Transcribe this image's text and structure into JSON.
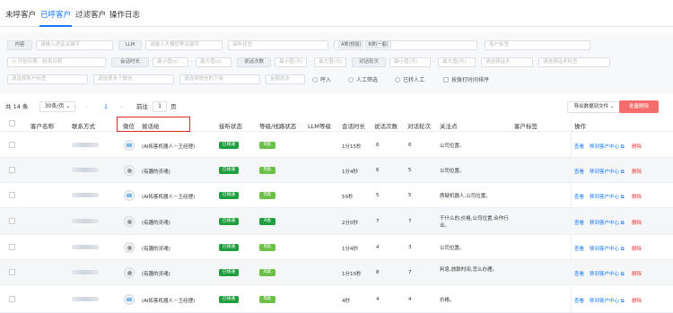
{
  "tabs": [
    {
      "label": "未呼客户"
    },
    {
      "label": "已呼客户"
    },
    {
      "label": "过滤客户"
    },
    {
      "label": "操作日志"
    }
  ],
  "filters": {
    "content_label": "内容",
    "content_ph": "请输入语音关键字",
    "llm_label": "LLM",
    "llm_ph": "请输入大模型等关键字",
    "connect_status_ph": "接听状态",
    "level_tags": [
      "A类(较强)",
      "B类(一般)"
    ],
    "customer_tag_ph": "客户标签",
    "start_date_ph": "开始日期",
    "end_date_ph": "结束日期",
    "duration_label": "会话时长",
    "duration_min": "最小值(s)",
    "duration_max": "最大值(s)",
    "count_label": "说话次数",
    "count_min": "最小值(次)",
    "count_max": "最大值(次)",
    "rounds_label": "对话轮次",
    "rounds_min": "最小值(次)",
    "rounds_max": "最大值(次)",
    "script_ph": "请选择话术",
    "script_tag_ph": "请选择话术标签",
    "account_ph": "请选择账户标签",
    "multi_ph": "请选择多个微信",
    "wechat_ph": "请选择微信的下级",
    "amount_ph": "金额状态",
    "check_called": "呼入",
    "check_manual": "人工筛选",
    "check_added": "已转人工",
    "check_sort": "按拨打时间排序"
  },
  "pagination": {
    "total": "共 14 条",
    "size": "30条/页",
    "page": "1",
    "goto": "前往",
    "goto_value": "1",
    "page_unit": "页"
  },
  "actions": {
    "export": "导出数据到文件",
    "delete": "批量删除"
  },
  "columns": [
    "客户名称",
    "联系方式",
    "微信",
    "拨话给",
    "接听状态",
    "等级/线路状态",
    "LLM等级",
    "会话时长",
    "说话次数",
    "对话轮次",
    "关注点",
    "客户标签",
    "操作"
  ],
  "rows": [
    {
      "avatar": "robot-avatar",
      "dial": "(AI拓客机器人－王经理)",
      "status": "已接通",
      "level": "B类",
      "level_color": "#6cc04a",
      "duration": "1分15秒",
      "count": "6",
      "rounds": "6",
      "focus": "公司位置。",
      "actions": [
        "查看",
        "移到客户中心",
        "删除"
      ]
    },
    {
      "avatar": "person-avatar",
      "dial": "(有趣的灵魂)",
      "status": "已接通",
      "level": "B类",
      "level_color": "#6cc04a",
      "duration": "1分4秒",
      "count": "6",
      "rounds": "5",
      "focus": "公司位置。",
      "actions": [
        "查看",
        "移到客户中心",
        "删除"
      ]
    },
    {
      "avatar": "robot-avatar",
      "dial": "(AI拓客机器人－王经理)",
      "status": "已接通",
      "level": "B类",
      "level_color": "#6cc04a",
      "duration": "59秒",
      "count": "5",
      "rounds": "5",
      "focus": "质疑机器人,公司位置。",
      "actions": [
        "查看",
        "移到客户中心",
        "删除"
      ]
    },
    {
      "avatar": "person-avatar",
      "dial": "(有趣的灵魂)",
      "status": "已接通",
      "level": "A类",
      "level_color": "#1e9e3e",
      "duration": "2分0秒",
      "count": "7",
      "rounds": "7",
      "focus": "干什么的,价格,公司位置,合作行业。",
      "actions": [
        "查看",
        "移到客户中心",
        "删除"
      ]
    },
    {
      "avatar": "person-avatar",
      "dial": "(有趣的灵魂)",
      "status": "已接通",
      "level": "B类",
      "level_color": "#6cc04a",
      "duration": "1分4秒",
      "count": "4",
      "rounds": "3",
      "focus": "公司位置。",
      "actions": [
        "查看",
        "移到客户中心",
        "删除"
      ]
    },
    {
      "avatar": "person-avatar",
      "dial": "(有趣的灵魂)",
      "status": "已接通",
      "level": "B类",
      "level_color": "#6cc04a",
      "duration": "1分10秒",
      "count": "8",
      "rounds": "7",
      "focus": "利息,放款时间,怎么办理。",
      "actions": [
        "查看",
        "移到客户中心",
        "删除"
      ]
    },
    {
      "avatar": "robot-avatar",
      "dial": "(AI拓客机器人－王经理)",
      "status": "已接通",
      "level": "B类",
      "level_color": "#6cc04a",
      "duration": "4秒",
      "count": "4",
      "rounds": "4",
      "focus": "价格。",
      "actions": [
        "查看",
        "移到客户中心",
        "删除"
      ]
    }
  ],
  "colors": {
    "accent": "#1677ff",
    "status_green": "#1e9e3e",
    "level_b": "#6cc04a",
    "danger": "#f56c6c",
    "highlight": "#d92b2b"
  }
}
